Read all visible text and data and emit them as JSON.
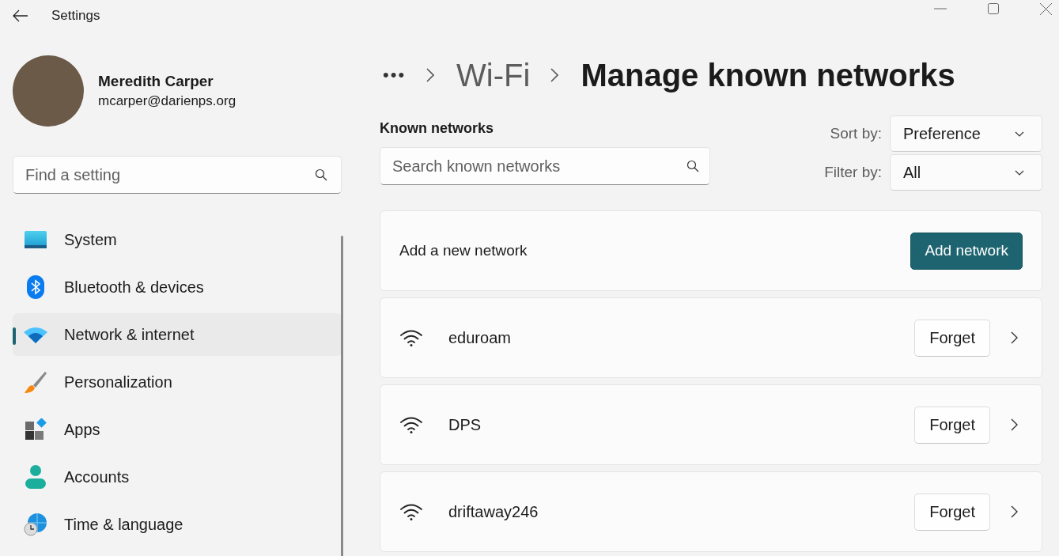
{
  "window": {
    "title": "Settings"
  },
  "profile": {
    "name": "Meredith Carper",
    "email": "mcarper@darienps.org"
  },
  "sidebar": {
    "search": {
      "placeholder": "Find a setting"
    },
    "items": [
      {
        "label": "System",
        "selected": false
      },
      {
        "label": "Bluetooth & devices",
        "selected": false
      },
      {
        "label": "Network & internet",
        "selected": true
      },
      {
        "label": "Personalization",
        "selected": false
      },
      {
        "label": "Apps",
        "selected": false
      },
      {
        "label": "Accounts",
        "selected": false
      },
      {
        "label": "Time & language",
        "selected": false
      }
    ]
  },
  "breadcrumb": {
    "overflow": "•••",
    "items": [
      "Wi-Fi",
      "Manage known networks"
    ]
  },
  "known_networks": {
    "heading": "Known networks",
    "search": {
      "placeholder": "Search known networks"
    },
    "sort": {
      "label": "Sort by:",
      "value": "Preference"
    },
    "filter": {
      "label": "Filter by:",
      "value": "All"
    },
    "add": {
      "label": "Add a new network",
      "button": "Add network"
    },
    "networks": [
      {
        "name": "eduroam",
        "button": "Forget"
      },
      {
        "name": "DPS",
        "button": "Forget"
      },
      {
        "name": "driftaway246",
        "button": "Forget"
      }
    ]
  }
}
